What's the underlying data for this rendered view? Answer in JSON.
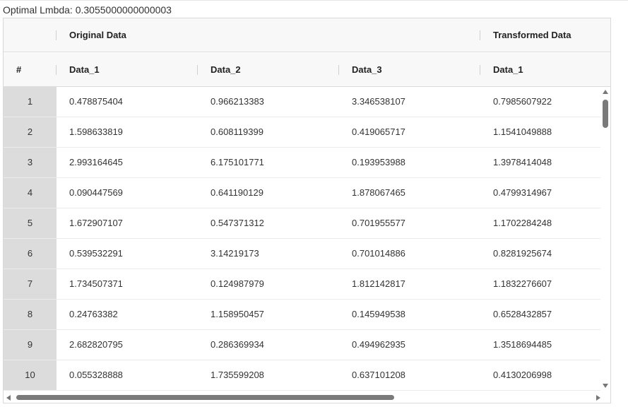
{
  "lambda_label": "Optimal Lmbda: 0.3055000000000003",
  "header": {
    "groups": [
      "",
      "Original Data",
      "Transformed Data"
    ],
    "columns": [
      "#",
      "Data_1",
      "Data_2",
      "Data_3",
      "Data_1"
    ]
  },
  "rows": [
    [
      "1",
      "0.478875404",
      "0.966213383",
      "3.346538107",
      "0.7985607922"
    ],
    [
      "2",
      "1.598633819",
      "0.608119399",
      "0.419065717",
      "1.1541049888"
    ],
    [
      "3",
      "2.993164645",
      "6.175101771",
      "0.193953988",
      "1.3978414048"
    ],
    [
      "4",
      "0.090447569",
      "0.641190129",
      "1.878067465",
      "0.4799314967"
    ],
    [
      "5",
      "1.672907107",
      "0.547371312",
      "0.701955577",
      "1.1702284248"
    ],
    [
      "6",
      "0.539532291",
      "3.14219173",
      "0.701014886",
      "0.8281925674"
    ],
    [
      "7",
      "1.734507371",
      "0.124987979",
      "1.812142817",
      "1.1832276607"
    ],
    [
      "8",
      "0.24763382",
      "1.158950457",
      "0.145949538",
      "0.6528432857"
    ],
    [
      "9",
      "2.682820795",
      "0.286369934",
      "0.494962935",
      "1.3518694485"
    ],
    [
      "10",
      "0.055328888",
      "1.735599208",
      "0.637101208",
      "0.4130206998"
    ]
  ]
}
